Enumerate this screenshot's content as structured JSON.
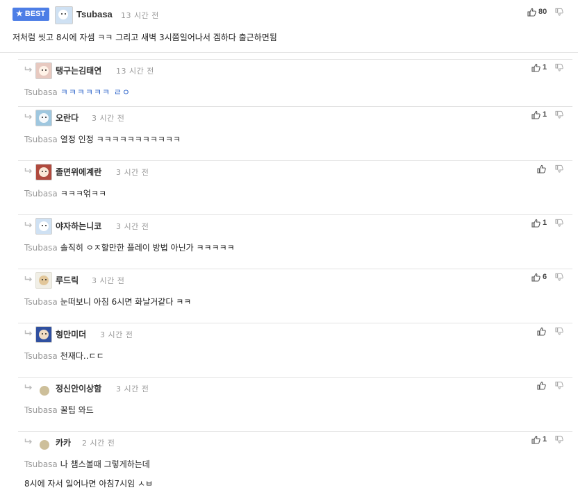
{
  "root_comment": {
    "badge": "BEST",
    "badge_icon": "star-icon",
    "author": "Tsubasa",
    "time": "13 시간 전",
    "text": "저처럼 씻고 8시에 자셈 ㅋㅋ 그리고 새벽 3시쯤일어나서 겜하다 출근하면됨",
    "likes": "80"
  },
  "replies": [
    {
      "author": "탱구는김태연",
      "time": "13 시간 전",
      "mention": "Tsubasa",
      "text": "ㅋㅋㅋㅋㅋㅋ ㄹㅇ",
      "text_style": "blue",
      "likes": "1",
      "avatar": "pink"
    },
    {
      "author": "오란다",
      "time": "3 시간 전",
      "mention": "Tsubasa",
      "text": "열정 인정 ㅋㅋㅋㅋㅋㅋㅋㅋㅋㅋㅋ",
      "likes": "1",
      "avatar": "cyan"
    },
    {
      "author": "졸면위에계란",
      "time": "3 시간 전",
      "mention": "Tsubasa",
      "text": "ㅋㅋㅋ얶ㅋㅋ",
      "likes": "",
      "avatar": "red"
    },
    {
      "author": "야자하는니코",
      "time": "3 시간 전",
      "mention": "Tsubasa",
      "text": "솔직히 ㅇㅈ할만한 플레이 방법 아닌가 ㅋㅋㅋㅋㅋ",
      "likes": "1",
      "avatar": "blue"
    },
    {
      "author": "루드릭",
      "time": "3 시간 전",
      "mention": "Tsubasa",
      "text": "눈떠보니 아침 6시면 화날거같다 ㅋㅋ",
      "likes": "6",
      "avatar": "cream"
    },
    {
      "author": "형만미더",
      "time": "3 시간 전",
      "mention": "Tsubasa",
      "text": "천재다..ㄷㄷ",
      "likes": "",
      "avatar": "flame"
    },
    {
      "author": "정신안이상함",
      "time": "3 시간 전",
      "mention": "Tsubasa",
      "text": "꿀팁 와드",
      "likes": "",
      "avatar": "dot"
    },
    {
      "author": "카카",
      "time": "2 시간 전",
      "mention": "Tsubasa",
      "text": "나 챔스볼때 그렇게하는데",
      "text_line2": "8시에 자서 일어나면 아침7시임 ㅅㅂ",
      "likes": "1",
      "avatar": "dot"
    }
  ],
  "icons": {
    "like": "thumbs-up-icon",
    "dislike": "thumbs-down-icon",
    "reply": "reply-arrow-icon"
  },
  "colors": {
    "badge": "#4d7ee6",
    "mention": "#999999",
    "highlight_text": "#2a62c9",
    "divider": "#e2e2e2"
  }
}
